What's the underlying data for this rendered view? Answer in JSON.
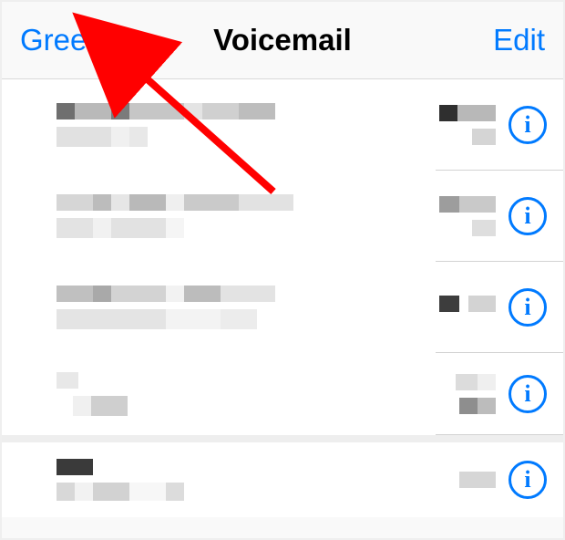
{
  "navbar": {
    "left_label": "Greeting",
    "title": "Voicemail",
    "right_label": "Edit"
  },
  "info_glyph": "i",
  "annotation": {
    "type": "arrow",
    "target": "greeting-button",
    "color": "#ff0000"
  }
}
